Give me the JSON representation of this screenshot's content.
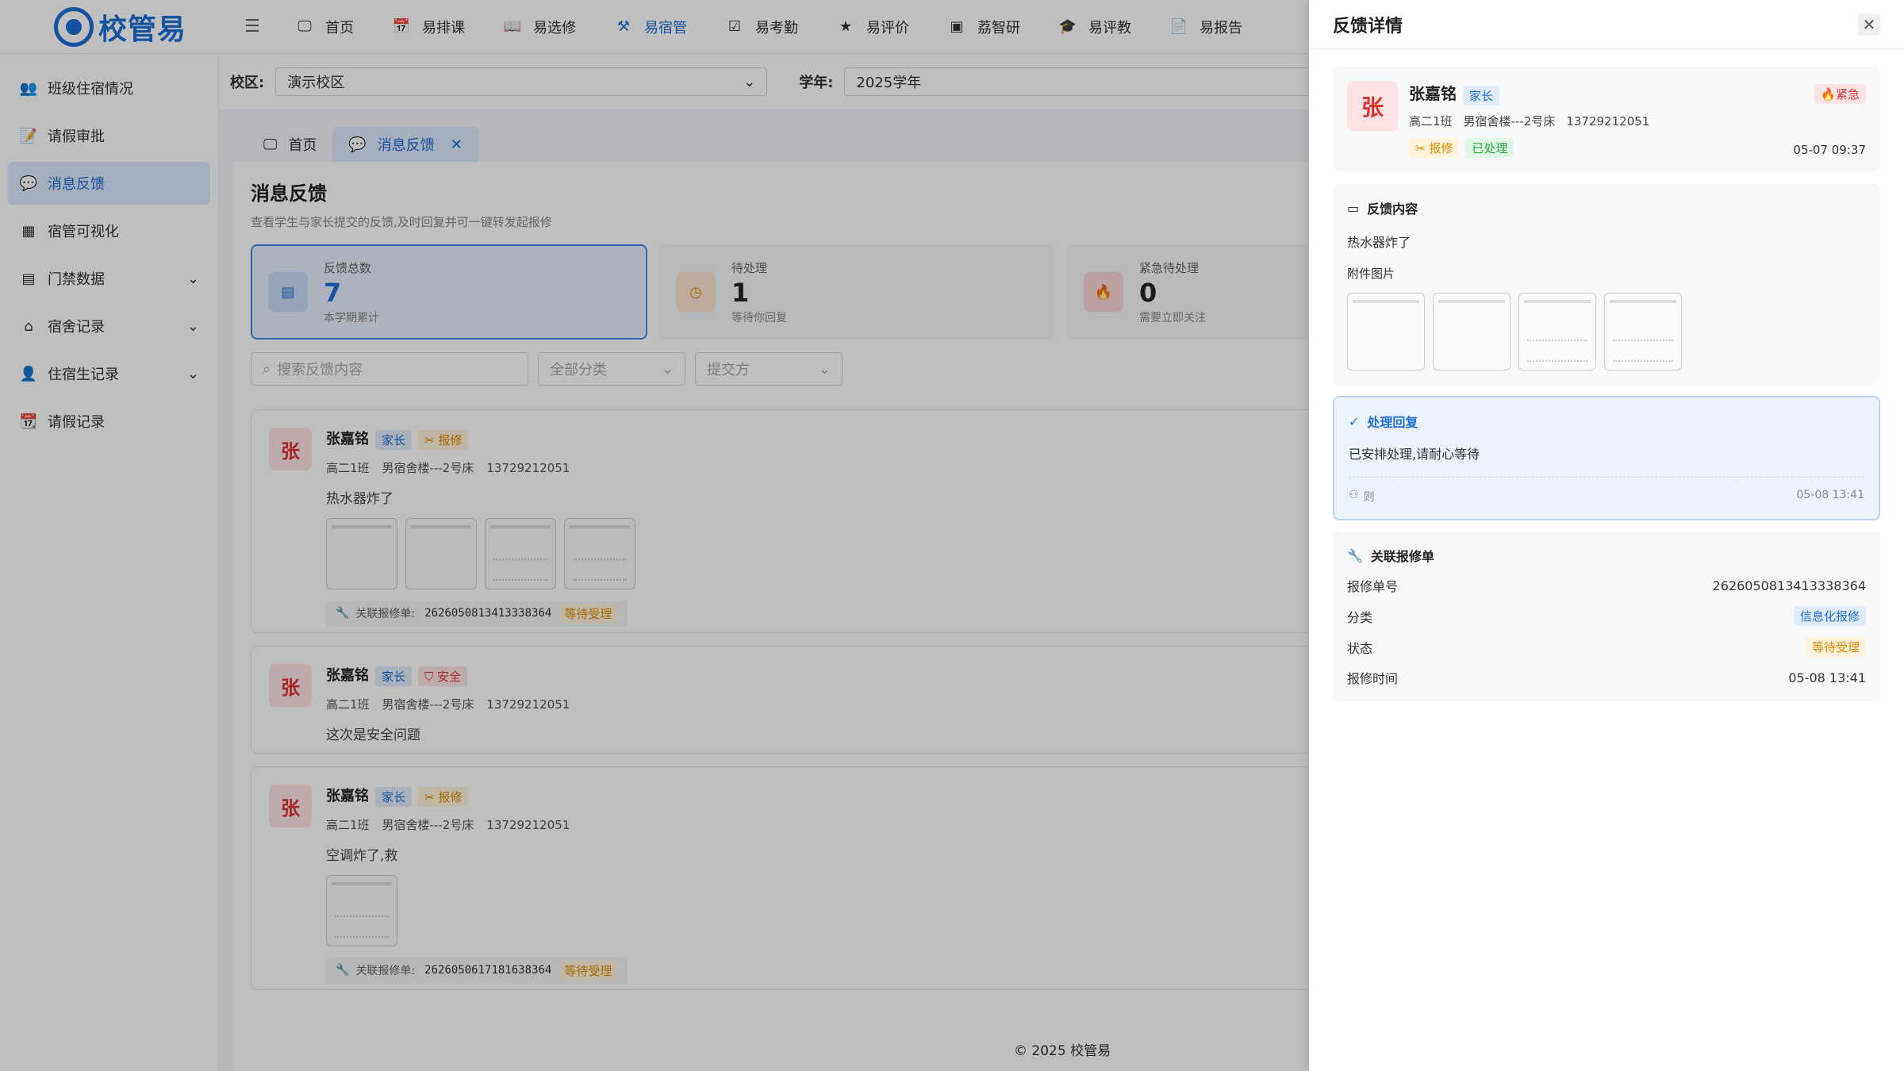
{
  "app": {
    "logo_text": "校管易"
  },
  "nav": [
    {
      "label": "首页",
      "icon": "presentation-icon"
    },
    {
      "label": "易排课",
      "icon": "calendar-icon"
    },
    {
      "label": "易选修",
      "icon": "book-icon"
    },
    {
      "label": "易宿管",
      "icon": "dorm-icon",
      "active": true
    },
    {
      "label": "易考勤",
      "icon": "calendar-check-icon"
    },
    {
      "label": "易评价",
      "icon": "star-icon"
    },
    {
      "label": "荔智研",
      "icon": "research-icon"
    },
    {
      "label": "易评教",
      "icon": "graduation-cap-icon"
    },
    {
      "label": "易报告",
      "icon": "report-icon"
    }
  ],
  "sidebar": [
    {
      "label": "班级住宿情况"
    },
    {
      "label": "请假审批"
    },
    {
      "label": "消息反馈",
      "active": true
    },
    {
      "label": "宿管可视化"
    },
    {
      "label": "门禁数据",
      "expandable": true
    },
    {
      "label": "宿舍记录",
      "expandable": true
    },
    {
      "label": "住宿生记录",
      "expandable": true
    },
    {
      "label": "请假记录"
    }
  ],
  "filters": {
    "campus_label": "校区:",
    "campus_value": "演示校区",
    "year_label": "学年:",
    "year_value": "2025学年"
  },
  "tabs": [
    {
      "label": "首页"
    },
    {
      "label": "消息反馈",
      "closable": true
    }
  ],
  "page": {
    "title": "消息反馈",
    "desc": "查看学生与家长提交的反馈,及时回复并可一键转发起报修"
  },
  "stats": [
    {
      "label": "反馈总数",
      "value": "7",
      "sub": "本学期累计"
    },
    {
      "label": "待处理",
      "value": "1",
      "sub": "等待你回复"
    },
    {
      "label": "紧急待处理",
      "value": "0",
      "sub": "需要立即关注"
    }
  ],
  "search": {
    "placeholder": "搜索反馈内容",
    "category": "全部分类",
    "submitter": "提交方"
  },
  "feedback": [
    {
      "avatar": "张",
      "name": "张嘉铭",
      "role": "家长",
      "category": "报修",
      "class": "高二1班",
      "bed": "男宿舍楼---2号床",
      "phone": "13729212051",
      "text": "热水器炸了",
      "repair_label": "关联报修单:",
      "repair_no": "2626050813413338364",
      "repair_status": "等待受理"
    },
    {
      "avatar": "张",
      "name": "张嘉铭",
      "role": "家长",
      "category": "安全",
      "class": "高二1班",
      "bed": "男宿舍楼---2号床",
      "phone": "13729212051",
      "text": "这次是安全问题"
    },
    {
      "avatar": "张",
      "name": "张嘉铭",
      "role": "家长",
      "category": "报修",
      "class": "高二1班",
      "bed": "男宿舍楼---2号床",
      "phone": "13729212051",
      "text": "空调炸了,救",
      "repair_label": "关联报修单:",
      "repair_no": "2626050617181638364",
      "repair_status": "等待受理"
    }
  ],
  "footer": "© 2025 校管易",
  "drawer": {
    "title": "反馈详情",
    "avatar": "张",
    "name": "张嘉铭",
    "role": "家长",
    "urgent": "紧急",
    "class": "高二1班",
    "bed": "男宿舍楼---2号床",
    "phone": "13729212051",
    "category": "报修",
    "status": "已处理",
    "time": "05-07 09:37",
    "content_title": "反馈内容",
    "content_text": "热水器炸了",
    "attach_label": "附件图片",
    "reply_title": "处理回复",
    "reply_text": "已安排处理,请耐心等待",
    "reply_by": "则",
    "reply_time": "05-08 13:41",
    "repair_title": "关联报修单",
    "repair_rows": [
      {
        "k": "报修单号",
        "v": "2626050813413338364"
      },
      {
        "k": "分类",
        "v": "信息化报修"
      },
      {
        "k": "状态",
        "v": "等待受理"
      },
      {
        "k": "报修时间",
        "v": "05-08 13:41"
      }
    ]
  },
  "colors": {
    "accent": "#1d6fd6",
    "urgent": "#d33",
    "orange": "#e08a00",
    "green": "#28a745"
  }
}
